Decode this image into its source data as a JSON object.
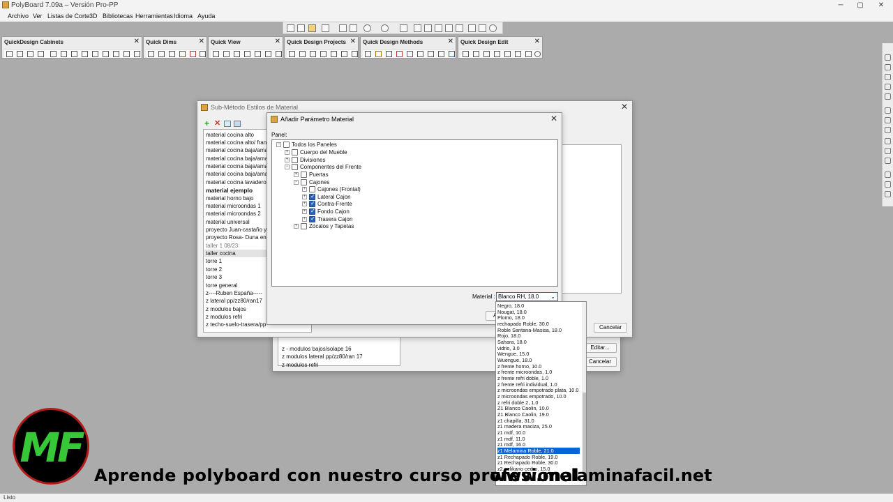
{
  "window": {
    "title": "PolyBoard 7.09a – Versión Pro-PP",
    "minimize": "─",
    "maximize": "▢",
    "close": "✕"
  },
  "menu": [
    "Archivo",
    "Ver",
    "Listas de Corte",
    "3D",
    "Bibliotecas",
    "Herramientas",
    "Idioma",
    "Ayuda"
  ],
  "toolbars": [
    {
      "title": "QuickDesign Cabinets",
      "close": "✕"
    },
    {
      "title": "Quick Dims",
      "close": "✕"
    },
    {
      "title": "Quick View",
      "close": "✕"
    },
    {
      "title": "Quick Design Projects",
      "close": "✕"
    },
    {
      "title": "Quick Design Methods",
      "close": "✕"
    },
    {
      "title": "Quick Design Edit",
      "close": "✕"
    }
  ],
  "status": "Listo",
  "back_dialog": {
    "title": "Sub-Método Estilos de Material",
    "close": "✕",
    "cancel_label": "Cancelar",
    "materials": [
      "material cocina alto",
      "material cocina alto/ frances",
      "material cocina baja/amarre",
      "material cocina baja/amarre",
      "material cocina baja/amarre",
      "material cocina baja/amarre",
      "material cocina lavadero-est",
      "material ejemplo",
      "material horno bajo",
      "material microondas 1",
      "material microondas 2",
      "material universal",
      "proyecto Juan-castaño y bl",
      "proyecto Rosa- Duna enteri",
      "taller 1 08/23",
      "taller cocina",
      "torre 1",
      "torre 2",
      "torre 3",
      "torre general",
      "z----Ruben España-----",
      "z lateral pp/zz80/ran17",
      "z modulos bajos",
      "z modulos refri",
      "z techo-suelo-trasera/pp"
    ]
  },
  "back_dialog2": {
    "edit_label": "Editar...",
    "cancel_label": "Cancelar",
    "items": [
      "z - modulos bajos/solape 16",
      "z modulos lateral pp/zz80/ran 17",
      "z modulos refri"
    ]
  },
  "front_dialog": {
    "title": "Añadir Parámetro Material",
    "close": "✕",
    "panel_label": "Panel:",
    "material_label": "Material :",
    "material_value": "Blanco RH, 18.0",
    "ok_partial": "A",
    "tree": [
      {
        "label": "Todos los Paneles",
        "checked": false,
        "expander": "−"
      },
      {
        "label": "Cuerpo del Mueble",
        "checked": false,
        "expander": "+"
      },
      {
        "label": "Divisiones",
        "checked": false,
        "expander": "+"
      },
      {
        "label": "Componentes del Frente",
        "checked": false,
        "expander": "−"
      },
      {
        "label": "Puertas",
        "checked": false,
        "expander": "+"
      },
      {
        "label": "Cajones",
        "checked": false,
        "expander": "−"
      },
      {
        "label": "Cajones (Frontal)",
        "checked": false,
        "expander": "+"
      },
      {
        "label": "Lateral Cajon",
        "checked": true,
        "expander": "+"
      },
      {
        "label": "Contra-Frente",
        "checked": true,
        "expander": "+"
      },
      {
        "label": "Fondo Cajon",
        "checked": true,
        "expander": "+"
      },
      {
        "label": "Trasera Cajon",
        "checked": true,
        "expander": "+"
      },
      {
        "label": "Zócalos y Tapetas",
        "checked": false,
        "expander": "+"
      }
    ]
  },
  "dropdown": {
    "selected": "z1 Melamina Roble, 21.0",
    "options": [
      "Negro, 18.0",
      "Nougat, 18.0",
      "Plomo, 18.0",
      "rechapado Roble, 30.0",
      "Roble Santana-Masisa, 18.0",
      "Rojo, 18.0",
      "Sahara, 18.0",
      "vidrio, 3.0",
      "Wengue, 15.0",
      "Wuengue, 18.0",
      "z frente horno, 10.0",
      "z frente microondas, 1.0",
      "z frente refri doble, 1.0",
      "z frente refri individual, 1.0",
      "z microondas empotrado plata, 10.0",
      "z microondas empotrado, 10.0",
      "z refri doble 2, 1.0",
      "Z1 Blanco Caolin, 10.0",
      "Z1 Blanco Caolin, 19.0",
      "z1 chapilla, 31.0",
      "z1 madera maciza, 25.0",
      "z1 mdf, 10.0",
      "z1 mdf, 11.0",
      "z1 mdf, 16.0",
      "z1 Melamina Roble, 21.0",
      "z1 Rechapado Roble, 19.0",
      "z1 Rechapado Roble, 30.0",
      "z2 pelikano cedro, 15.0"
    ]
  },
  "branding": {
    "logo": "MF",
    "banner": "Aprende polyboard con nuestro curso profesional",
    "url": "www.melaminafacil.net"
  }
}
